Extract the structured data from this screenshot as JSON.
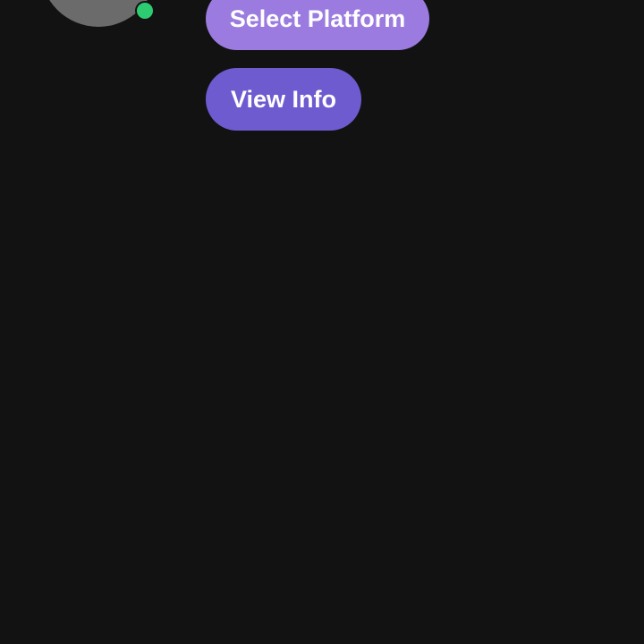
{
  "profile": {
    "avatar_color": "#6b6b6b",
    "status": "online",
    "status_color": "#2ecc71"
  },
  "actions": {
    "select_platform_label": "Select Platform",
    "select_platform_color": "#9b7be0",
    "view_info_label": "View Info",
    "view_info_color": "#6e5bd0"
  },
  "theme": {
    "background": "#121212"
  }
}
